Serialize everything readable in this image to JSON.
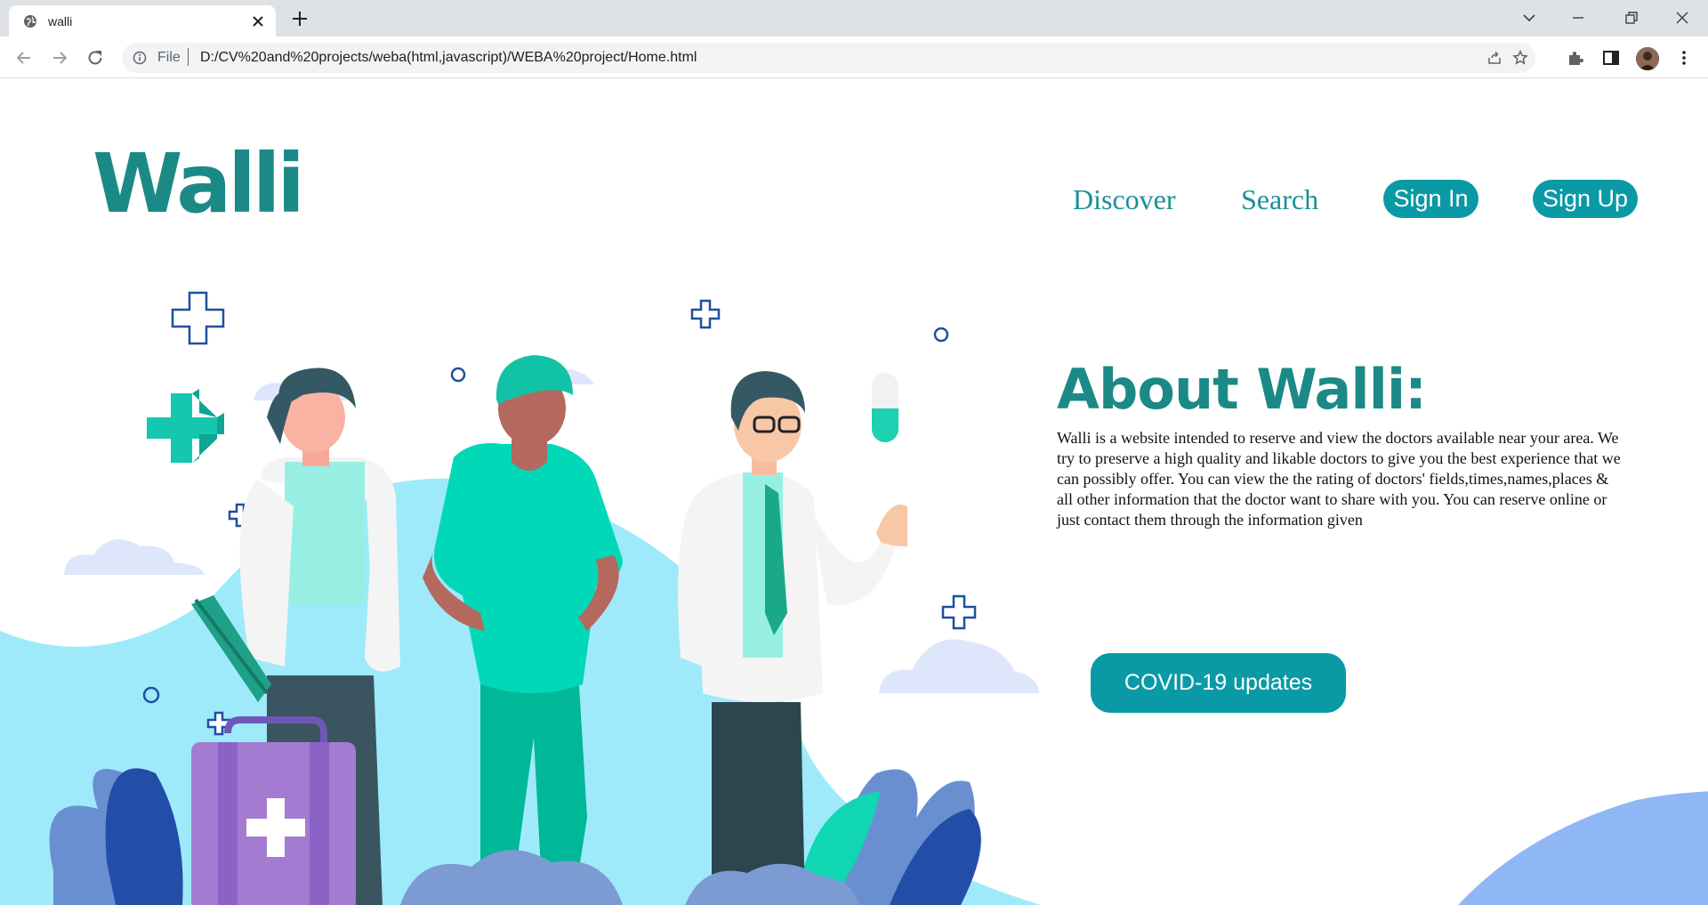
{
  "browser": {
    "tab_title": "walli",
    "file_label": "File",
    "url": "D:/CV%20and%20projects/weba(html,javascript)/WEBA%20project/Home.html"
  },
  "header": {
    "logo": "Walli",
    "nav": {
      "discover": "Discover",
      "search": "Search",
      "sign_in": "Sign In",
      "sign_up": "Sign Up"
    }
  },
  "about": {
    "title": "About Walli:",
    "text": "Walli is a website intended to reserve and view the doctors available near your area. We try to preserve a high quality and likable doctors to give you the best experience that we can possibly offer. You can view the the rating of doctors' fields,times,names,places & all other information that the doctor want to share with you. You can reserve online or just contact them through the information given",
    "covid_button": "COVID-19 updates"
  },
  "colors": {
    "brand_teal": "#1b8a86",
    "button_teal": "#0a9aa6",
    "light_blue": "#9eeafb",
    "scrub_green": "#00c9a7"
  },
  "icons": {
    "tab_favicon": "globe-icon",
    "back": "arrow-left-icon",
    "forward": "arrow-right-icon",
    "reload": "reload-icon",
    "info": "info-icon",
    "share": "share-icon",
    "bookmark": "star-icon",
    "extensions": "puzzle-icon",
    "side_panel": "side-panel-icon",
    "menu": "kebab-menu-icon"
  }
}
